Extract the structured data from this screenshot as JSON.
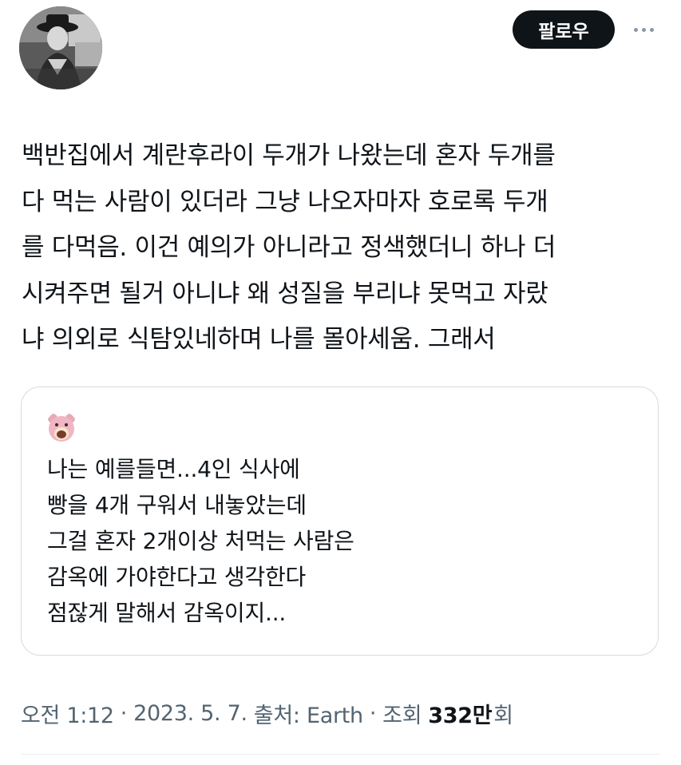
{
  "header": {
    "follow_label": "팔로우",
    "more_icon": "more-horizontal-icon"
  },
  "tweet": {
    "lines": [
      "백반집에서 계란후라이 두개가 나왔는데 혼자 두개를",
      "다 먹는 사람이 있더라 그냥 나오자마자 호로록 두개",
      "를 다먹음. 이건 예의가 아니라고 정색했더니 하나 더",
      "시켜주면 될거 아니냐 왜 성질을 부리냐 못먹고 자랐",
      "냐 의외로 식탐있네하며 나를 몰아세움. 그래서"
    ]
  },
  "quote": {
    "avatar_icon": "bear-avatar-icon",
    "lines": [
      "나는 예를들면...4인 식사에",
      "빵을 4개 구워서 내놓았는데",
      "그걸 혼자 2개이상 처먹는 사람은",
      "감옥에 가야한다고 생각한다",
      "점잖게 말해서 감옥이지..."
    ]
  },
  "meta": {
    "time": "오전 1:12",
    "separator": "·",
    "date": "2023. 5. 7.",
    "source": "출처: Earth",
    "views_label": "조회",
    "views_count": "332만",
    "views_suffix": "회"
  },
  "colors": {
    "text_primary": "#0f1419",
    "text_secondary": "#536471",
    "border": "#d5dbe0",
    "button_bg": "#0f1419"
  }
}
